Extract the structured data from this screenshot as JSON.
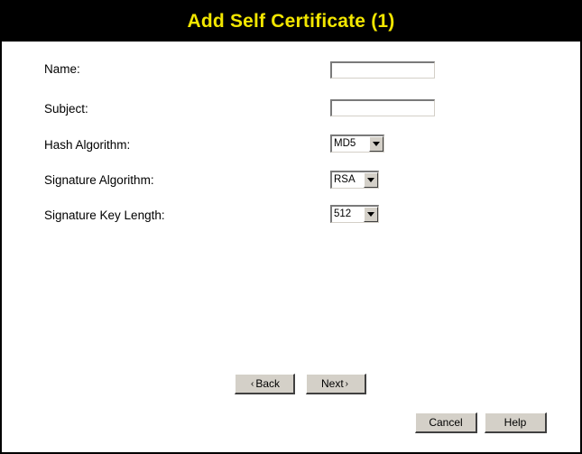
{
  "header": {
    "title": "Add Self Certificate (1)"
  },
  "fields": {
    "name": {
      "label": "Name:",
      "value": ""
    },
    "subject": {
      "label": "Subject:",
      "value": ""
    },
    "hash": {
      "label": "Hash Algorithm:",
      "value": "MD5"
    },
    "signature": {
      "label": "Signature Algorithm:",
      "value": "RSA"
    },
    "key_length": {
      "label": "Signature Key Length:",
      "value": "512"
    }
  },
  "buttons": {
    "back": "Back",
    "next": "Next",
    "cancel": "Cancel",
    "help": "Help"
  },
  "colors": {
    "title_background": "#000000",
    "title_text": "#f2e600",
    "button_face": "#d4d0c8"
  },
  "icons": {
    "back_caret": "caret-left-icon",
    "next_caret": "caret-right-icon",
    "dropdown_arrow": "chevron-down-icon"
  }
}
